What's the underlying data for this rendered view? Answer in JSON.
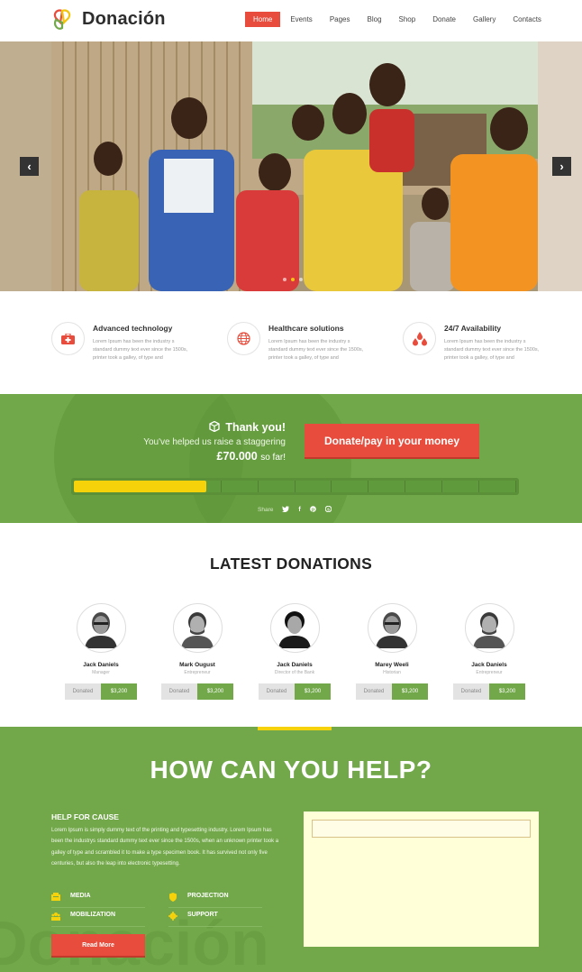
{
  "brand": {
    "name": "Donación"
  },
  "nav": [
    "Home",
    "Events",
    "Pages",
    "Blog",
    "Shop",
    "Donate",
    "Gallery",
    "Contacts"
  ],
  "colors": {
    "accent": "#e74c3c",
    "green": "#71a84a",
    "yellow": "#f5d20a"
  },
  "slider": {
    "prev_icon": "chevron-left",
    "next_icon": "chevron-right"
  },
  "features": [
    {
      "icon": "first-aid-kit-icon",
      "title": "Advanced technology",
      "text": "Lorem Ipsum has been the industry s standard dummy text ever since the 1500s, printer took a galley, of type and"
    },
    {
      "icon": "globe-icon",
      "title": "Healthcare solutions",
      "text": "Lorem Ipsum has been the industry s standard dummy text ever since the 1500s, printer took a galley, of type and"
    },
    {
      "icon": "drops-icon",
      "title": "24/7 Availability",
      "text": "Lorem Ipsum has been the industry s standard dummy text ever since the 1500s, printer took a galley, of type and"
    }
  ],
  "donate_band": {
    "thanks": "Thank you!",
    "raised_text": "You've helped us raise a staggering",
    "amount": "£70.000",
    "amount_suffix": "so far!",
    "button": "Donate/pay in your money",
    "progress_fraction": 0.3,
    "share_label": "Share"
  },
  "latest": {
    "title": "LATEST DONATIONS",
    "donors": [
      {
        "name": "Jack Daniels",
        "role": "Manager",
        "label": "Donated",
        "amount": "$3,200"
      },
      {
        "name": "Mark Ougust",
        "role": "Entrepreneur",
        "label": "Donated",
        "amount": "$3,200"
      },
      {
        "name": "Jack Daniels",
        "role": "Director of the Bank",
        "label": "Donated",
        "amount": "$3,200"
      },
      {
        "name": "Marey Weeli",
        "role": "Historian",
        "label": "Donated",
        "amount": "$3,200"
      },
      {
        "name": "Jack Daniels",
        "role": "Entrepreneur",
        "label": "Donated",
        "amount": "$3,200"
      }
    ]
  },
  "help": {
    "title": "HOW CAN YOU HELP?",
    "subtitle": "HELP FOR CAUSE",
    "body": "Lorem Ipsum is simply dummy text of the printing and typesetting industry. Lorem Ipsum has been the industrys standard dummy text ever since the 1500s, when an unknown printer took a galley of type and scrambled it to make a type specimen book. It has survived not only five centuries, but also the leap into electronic typesetting.",
    "causes": [
      "MEDIA",
      "PROJECTION",
      "MOBILIZATION",
      "SUPPORT"
    ],
    "read_more": "Read More",
    "watermark": "Donación"
  }
}
